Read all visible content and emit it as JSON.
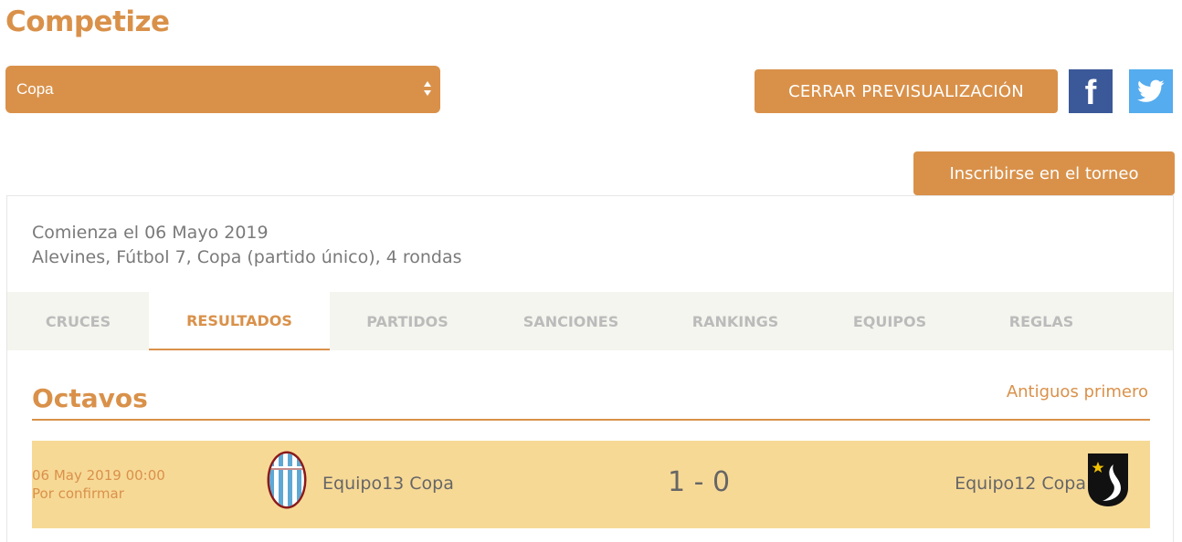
{
  "app": {
    "title": "Competize"
  },
  "competition_select": {
    "value": "Copa"
  },
  "actions": {
    "close_preview": "CERRAR PREVISUALIZACIÓN",
    "register": "Inscribirse en el torneo"
  },
  "social": {
    "facebook": "f"
  },
  "tournament": {
    "start": "Comienza el 06 Mayo 2019",
    "details": "Alevines, Fútbol 7, Copa (partido único), 4 rondas"
  },
  "tabs": [
    {
      "label": "CRUCES"
    },
    {
      "label": "RESULTADOS",
      "active": true
    },
    {
      "label": "PARTIDOS"
    },
    {
      "label": "SANCIONES"
    },
    {
      "label": "RANKINGS"
    },
    {
      "label": "EQUIPOS"
    },
    {
      "label": "REGLAS"
    }
  ],
  "section": {
    "title": "Octavos",
    "sort_label": "Antiguos primero"
  },
  "matches": [
    {
      "date": "06 May 2019 00:00",
      "status": "Por confirmar",
      "home_team": "Equipo13 Copa",
      "score": "1 - 0",
      "away_team": "Equipo12 Copa"
    }
  ],
  "colors": {
    "accent": "#d9914a",
    "tab_bar": "#f5f5ef",
    "match_row": "#f7d996",
    "facebook": "#3b5998",
    "twitter": "#55acee"
  },
  "icons": {
    "home_crest": "striped-shield-crest",
    "away_crest": "black-shield-star-crest",
    "twitter": "twitter-bird-icon",
    "facebook": "facebook-f-icon"
  }
}
